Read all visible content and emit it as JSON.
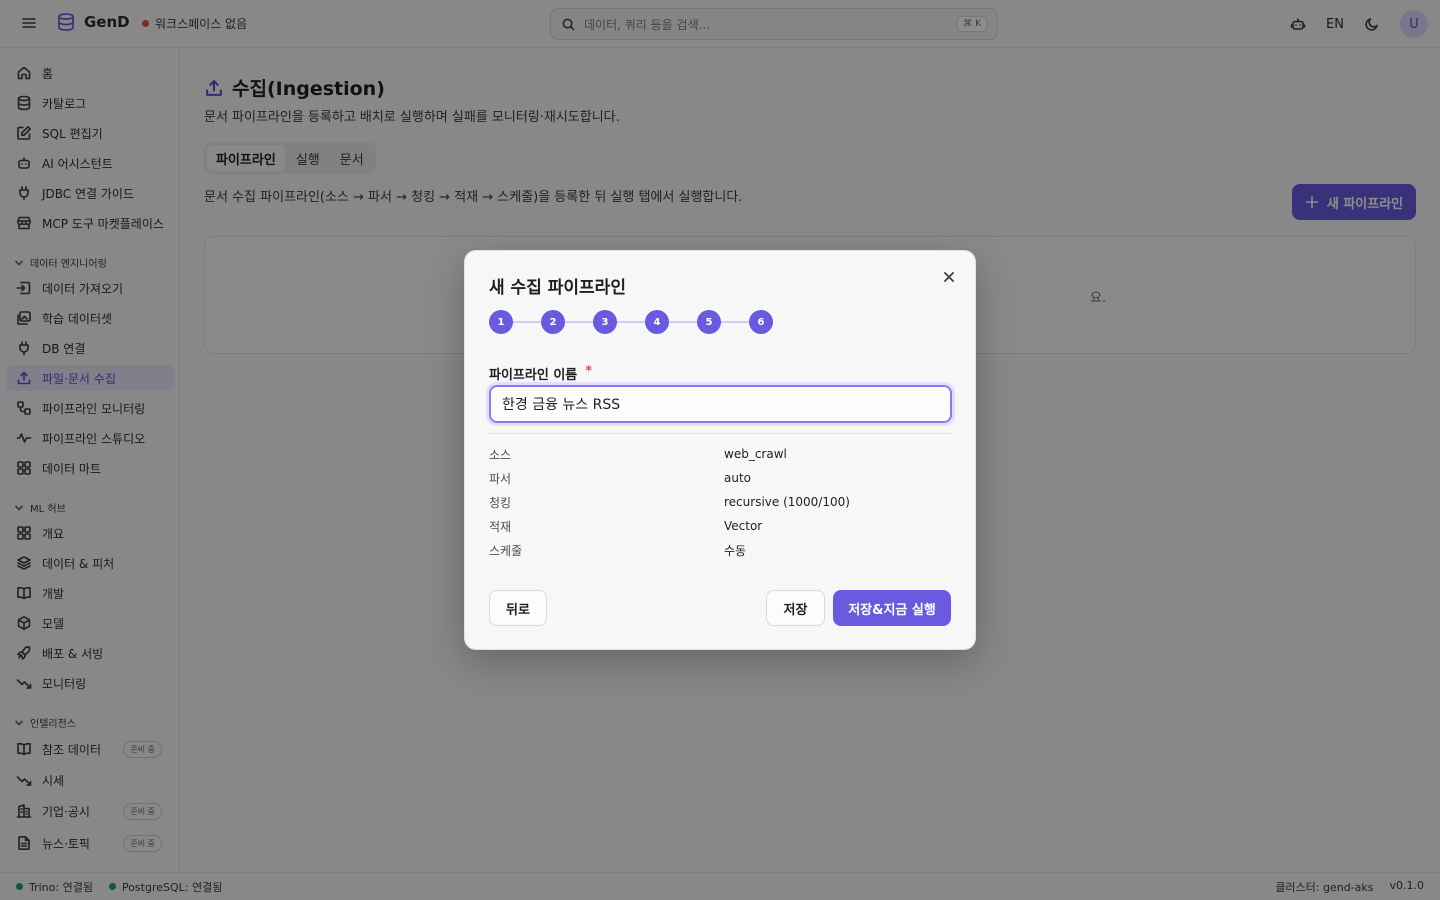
{
  "app": {
    "name": "GenD",
    "workspace": "워크스페이스 없음"
  },
  "search": {
    "placeholder": "데이터, 쿼리 등을 검색...",
    "shortcut": "⌘ K"
  },
  "topbar": {
    "lang": "EN",
    "avatar": "U"
  },
  "sidebar": {
    "items": [
      {
        "label": "홈",
        "icon": "home-icon"
      },
      {
        "label": "카탈로그",
        "icon": "database-icon"
      },
      {
        "label": "SQL 편집기",
        "icon": "edit-icon"
      },
      {
        "label": "AI 어시스턴트",
        "icon": "bot-icon"
      },
      {
        "label": "JDBC 연결 가이드",
        "icon": "plug-icon"
      },
      {
        "label": "MCP 도구 마켓플레이스",
        "icon": "store-icon"
      }
    ],
    "sections": [
      {
        "label": "데이터 엔지니어링",
        "items": [
          {
            "label": "데이터 가져오기",
            "icon": "import-icon"
          },
          {
            "label": "학습 데이터셋",
            "icon": "images-icon"
          },
          {
            "label": "DB 연결",
            "icon": "plug-icon"
          },
          {
            "label": "파일·문서 수집",
            "icon": "upload-icon",
            "active": true
          },
          {
            "label": "파이프라인 모니터링",
            "icon": "workflow-icon"
          },
          {
            "label": "파이프라인 스튜디오",
            "icon": "waveform-icon"
          },
          {
            "label": "데이터 마트",
            "icon": "grid-icon"
          }
        ]
      },
      {
        "label": "ML 허브",
        "items": [
          {
            "label": "개요",
            "icon": "grid-icon"
          },
          {
            "label": "데이터 & 피처",
            "icon": "layers-icon"
          },
          {
            "label": "개발",
            "icon": "book-icon"
          },
          {
            "label": "모델",
            "icon": "box-icon"
          },
          {
            "label": "배포 & 서빙",
            "icon": "rocket-icon"
          },
          {
            "label": "모니터링",
            "icon": "trend-icon"
          }
        ]
      },
      {
        "label": "인텔리전스",
        "items": [
          {
            "label": "참조 데이터",
            "icon": "book-icon",
            "badge": "준비 중"
          },
          {
            "label": "시세",
            "icon": "trend-icon"
          },
          {
            "label": "기업·공시",
            "icon": "building-icon",
            "badge": "준비 중"
          },
          {
            "label": "뉴스·토픽",
            "icon": "file-icon",
            "badge": "준비 중"
          }
        ]
      }
    ]
  },
  "main": {
    "title": "수집(Ingestion)",
    "description": "문서 파이프라인을 등록하고 배치로 실행하며 실패를 모니터링·재시도합니다.",
    "tabs": [
      "파이프라인",
      "실행",
      "문서"
    ],
    "tab_description": "문서 수집 파이프라인(소스 → 파서 → 청킹 → 적재 → 스케줄)을 등록한 뒤 실행 탭에서 실행합니다.",
    "new_button": "새 파이프라인",
    "empty_text": "요."
  },
  "modal": {
    "title": "새 수집 파이프라인",
    "steps": [
      "1",
      "2",
      "3",
      "4",
      "5",
      "6"
    ],
    "name_label": "파이프라인 이름",
    "required_mark": "*",
    "name_value": "한경 금융 뉴스 RSS",
    "summary": [
      {
        "key": "소스",
        "value": "web_crawl"
      },
      {
        "key": "파서",
        "value": "auto"
      },
      {
        "key": "청킹",
        "value": "recursive (1000/100)"
      },
      {
        "key": "적재",
        "value": "Vector"
      },
      {
        "key": "스케줄",
        "value": "수동"
      }
    ],
    "back_button": "뒤로",
    "save_button": "저장",
    "save_run_button": "저장&지금 실행"
  },
  "statusbar": {
    "trino": "Trino: 연결됨",
    "postgres": "PostgreSQL: 연결됨",
    "cluster": "클러스터: gend-aks",
    "version": "v0.1.0"
  },
  "colors": {
    "accent": "#6a5ae0",
    "connected": "#22a05a",
    "danger": "#e5484d"
  }
}
